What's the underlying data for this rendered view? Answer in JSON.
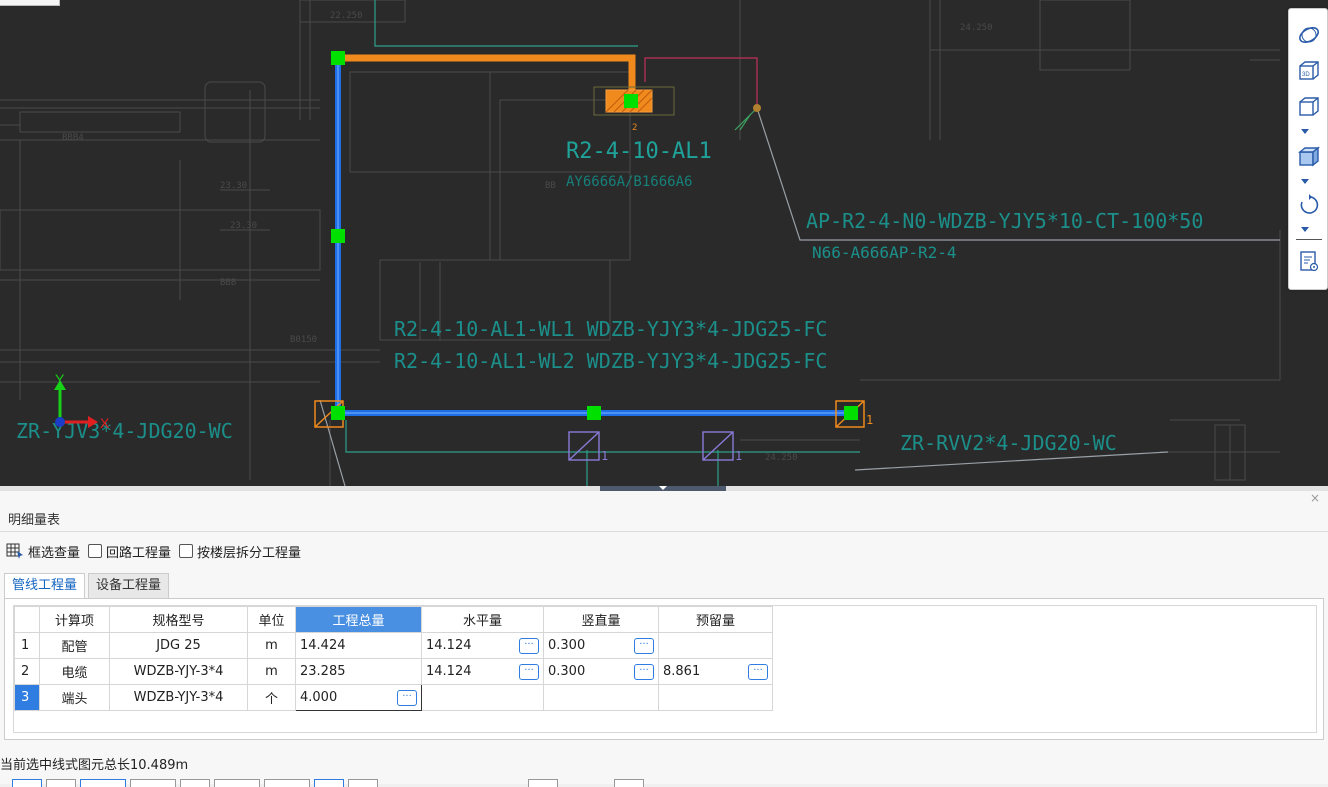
{
  "canvas": {
    "labels": {
      "panel_name": "R2-4-10-AL1",
      "panel_sub": "AY6666A/B1666A6",
      "ap_line": "AP-R2-4-N0-WDZB-YJY5*10-CT-100*50",
      "ap_sub": "N66-A666AP-R2-4",
      "wl1": "R2-4-10-AL1-WL1 WDZB-YJY3*4-JDG25-FC",
      "wl2": "R2-4-10-AL1-WL2 WDZB-YJY3*4-JDG25-FC",
      "zr_left": "ZR-YJV3*4-JDG20-WC",
      "zr_right": "ZR-RVV2*4-JDG20-WC",
      "axis_x": "X",
      "axis_y": "Y",
      "node_2": "2",
      "node_1a": "1",
      "node_1b": "1",
      "node_1c": "1"
    },
    "colors": {
      "background": "#2a2a2a",
      "pipe_blue": "#1e6fe6",
      "pipe_orange": "#f08a1c",
      "grip_green": "#00e000",
      "text_cyan": "#1fa29a"
    }
  },
  "toolbar": {
    "icons": [
      "orbit-icon",
      "3d-view-icon",
      "box-view-icon",
      "box-solid-icon",
      "rotate-icon",
      "display-settings-icon"
    ]
  },
  "panel": {
    "title": "明细量表",
    "close": "×",
    "options": {
      "frame_select": "框选查量",
      "loop_qty": "回路工程量",
      "split_by_floor": "按楼层拆分工程量"
    },
    "tabs": [
      "管线工程量",
      "设备工程量"
    ],
    "grid": {
      "headers": [
        "计算项",
        "规格型号",
        "单位",
        "工程总量",
        "水平量",
        "竖直量",
        "预留量"
      ],
      "rows": [
        {
          "no": "1",
          "item": "配管",
          "spec": "JDG 25",
          "unit": "m",
          "total": "14.424",
          "horizontal": "14.124",
          "vertical": "0.300",
          "reserve": ""
        },
        {
          "no": "2",
          "item": "电缆",
          "spec": "WDZB-YJY-3*4",
          "unit": "m",
          "total": "23.285",
          "horizontal": "14.124",
          "vertical": "0.300",
          "reserve": "8.861"
        },
        {
          "no": "3",
          "item": "端头",
          "spec": "WDZB-YJY-3*4",
          "unit": "个",
          "total": "4.000",
          "horizontal": "",
          "vertical": "",
          "reserve": ""
        }
      ],
      "dots_label": "···"
    },
    "status": "当前选中线式图元总长10.489m"
  }
}
